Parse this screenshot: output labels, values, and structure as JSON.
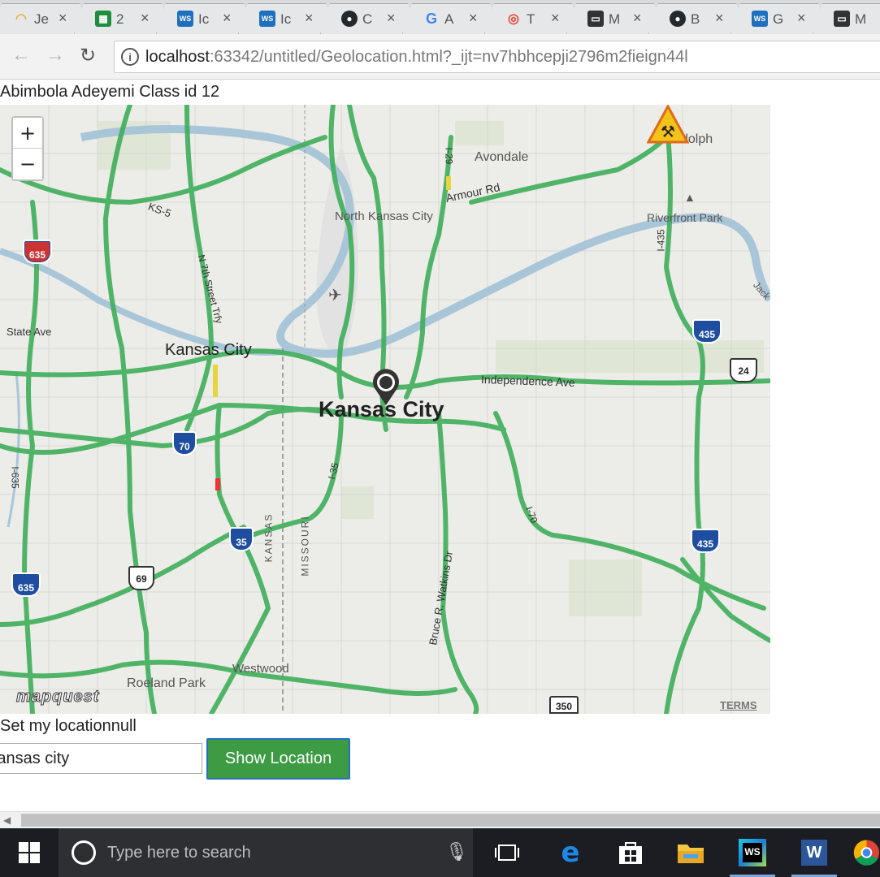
{
  "browser": {
    "tabs": [
      {
        "title": "Je",
        "icon": "rainbow-favicon-icon",
        "color": "#e9b03b"
      },
      {
        "title": "2",
        "icon": "sheets-favicon-icon",
        "color": "#1e8e3e"
      },
      {
        "title": "Ic",
        "icon": "webstorm-favicon-icon",
        "color": "#1f6fbf"
      },
      {
        "title": "Ic",
        "icon": "webstorm-favicon-icon",
        "color": "#1f6fbf"
      },
      {
        "title": "C",
        "icon": "github-favicon-icon",
        "color": "#24292e"
      },
      {
        "title": "A",
        "icon": "google-favicon-icon",
        "color": "#4285f4"
      },
      {
        "title": "T",
        "icon": "chrome-ext-favicon-icon",
        "color": "#ea4335"
      },
      {
        "title": "M",
        "icon": "classroom-favicon-icon",
        "color": "#333333"
      },
      {
        "title": "B",
        "icon": "github-favicon-icon",
        "color": "#24292e"
      },
      {
        "title": "G",
        "icon": "webstorm-favicon-icon",
        "color": "#1f6fbf"
      },
      {
        "title": "M",
        "icon": "classroom-favicon-icon",
        "color": "#333333"
      }
    ],
    "url_host": "localhost",
    "url_rest": ":63342/untitled/Geolocation.html?_ijt=nv7hbhcepji2796m2fieign44l"
  },
  "page": {
    "heading": "Abimbola Adeyemi Class id 12",
    "location_line": "Set my locationnull",
    "location_input_value": "Kansas city",
    "show_button": "Show Location"
  },
  "map": {
    "zoom_in": "+",
    "zoom_out": "−",
    "brand": "mapquest",
    "terms": "TERMS",
    "labels": {
      "avondale": "Avondale",
      "randolph": "dolph",
      "north_kc": "North Kansas City",
      "armour_rd": "Armour Rd",
      "riverfront": "Riverfront Park",
      "state_ave": "State Ave",
      "kc_ks": "Kansas City",
      "kc_mo": "Kansas City",
      "independence": "Independence Ave",
      "westwood": "Westwood",
      "roeland": "Roeland Park",
      "kansas_state": "KANSAS",
      "missouri_state": "MISSOURI",
      "bruce_watkins": "Bruce R. Watkins Dr",
      "ks5": "KS-5",
      "n7th": "N 7th Street Trfy",
      "i29": "I-29",
      "i35": "I-35",
      "i70": "I-70",
      "i435": "I-435",
      "i635": "I-635",
      "jack": "Jack"
    },
    "shields": {
      "i635_top": "635",
      "i635_bottom": "635",
      "i435_top": "435",
      "i435_bottom": "435",
      "i70": "70",
      "i35": "35",
      "us69": "69",
      "us24": "24",
      "us350": "350"
    },
    "colors": {
      "traffic": "#3fae5a",
      "river": "#a9c6d9",
      "water_fill": "#bcd3e2"
    }
  },
  "taskbar": {
    "search_placeholder": "Type here to search",
    "apps": [
      "task-view-icon",
      "edge-icon",
      "store-icon",
      "file-explorer-icon",
      "webstorm-icon",
      "word-icon",
      "chrome-icon"
    ]
  }
}
